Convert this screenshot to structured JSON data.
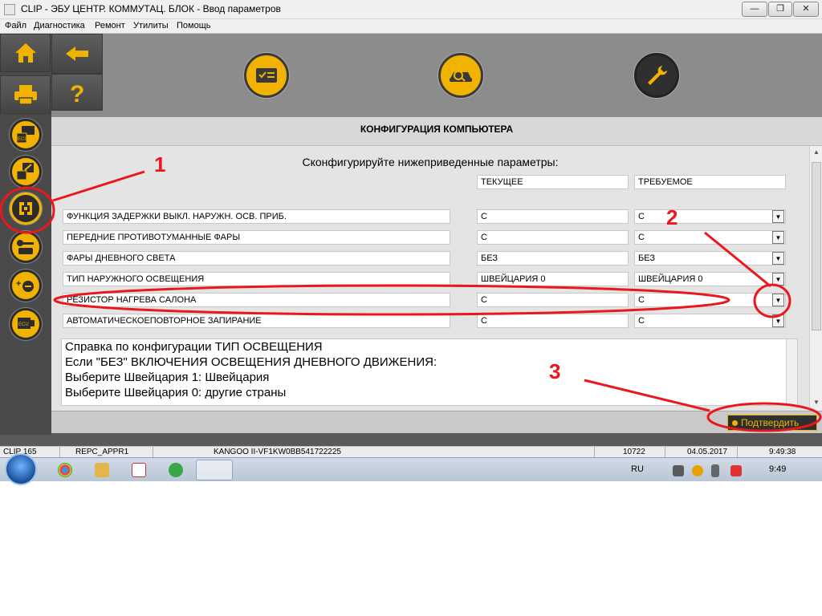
{
  "window": {
    "title": "CLIP - ЭБУ ЦЕНТР. КОММУТАЦ. БЛОК - Ввод параметров",
    "min": "—",
    "max": "❐",
    "close": "✕"
  },
  "menu": [
    "Файл",
    "Диагностика",
    "Ремонт",
    "Утилиты",
    "Помощь"
  ],
  "panel": {
    "title": "КОНФИГУРАЦИЯ КОМПЬЮТЕРА",
    "instruction": "Сконфигурируйте нижеприведенные параметры:",
    "col_current": "ТЕКУЩЕЕ",
    "col_required": "ТРЕБУЕМОЕ"
  },
  "rows": [
    {
      "label": "ФУНКЦИЯ ЗАДЕРЖКИ ВЫКЛ. НАРУЖН. ОСВ. ПРИБ.",
      "current": "С",
      "required": "С"
    },
    {
      "label": "ПЕРЕДНИЕ ПРОТИВОТУМАННЫЕ ФАРЫ",
      "current": "С",
      "required": "С"
    },
    {
      "label": "ФАРЫ ДНЕВНОГО СВЕТА",
      "current": "БЕЗ",
      "required": "БЕЗ"
    },
    {
      "label": "ТИП НАРУЖНОГО ОСВЕЩЕНИЯ",
      "current": "ШВЕЙЦАРИЯ 0",
      "required": "ШВЕЙЦАРИЯ 0"
    },
    {
      "label": "РЕЗИСТОР НАГРЕВА САЛОНА",
      "current": "С",
      "required": "С"
    },
    {
      "label": "АВТОМАТИЧЕСКОЕПОВТОРНОЕ ЗАПИРАНИЕ",
      "current": "С",
      "required": "С"
    }
  ],
  "help_text": [
    "Справка по конфигурации ТИП ОСВЕЩЕНИЯ",
    "Если \"БЕЗ\" ВКЛЮЧЕНИЯ ОСВЕЩЕНИЯ ДНЕВНОГО ДВИЖЕНИЯ:",
    "Выберите Швейцария 1: Швейцария",
    "Выберите Швейцария 0: другие страны"
  ],
  "confirm_label": "Подтвердить",
  "status": {
    "clip": "CLIP 165",
    "repc": "REPC_APPR1",
    "vehicle": "KANGOO II-VF1KW0BB541722225",
    "code": "10722",
    "date": "04.05.2017",
    "time": "9:49:38"
  },
  "taskbar": {
    "lang": "RU",
    "clock": "9:49"
  },
  "annotations": {
    "n1": "1",
    "n2": "2",
    "n3": "3"
  },
  "colors": {
    "accent": "#f2b200",
    "annotation": "#e8181e"
  }
}
